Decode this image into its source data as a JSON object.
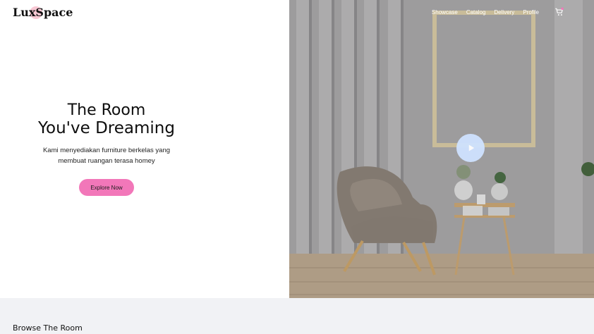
{
  "brand": {
    "name": "LuxSpace"
  },
  "nav": {
    "items": [
      "Showcase",
      "Catalog",
      "Delivery",
      "Profile"
    ],
    "cart_icon": "cart-icon"
  },
  "hero": {
    "title_line1": "The Room",
    "title_line2": "You've Dreaming",
    "description_line1": "Kami menyediakan furniture berkelas yang",
    "description_line2": "membuat ruangan terasa homey",
    "cta_label": "Explore Now",
    "play_icon": "play-icon"
  },
  "section": {
    "browse_title": "Browse The Room"
  },
  "colors": {
    "accent": "#f277b9",
    "play": "#cfe2ff",
    "strip": "#f1f2f5"
  }
}
